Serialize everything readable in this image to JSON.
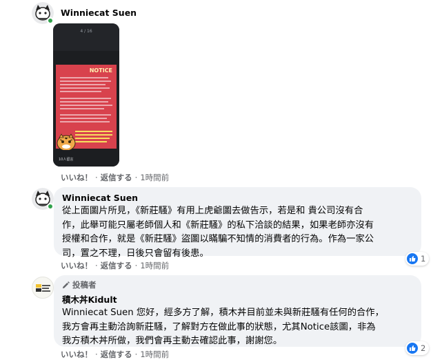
{
  "comments": [
    {
      "author": "Winniecat Suen",
      "image": {
        "page_counter": "4 / 16",
        "notice_title": "NOTICE",
        "footer_text": "10人留言"
      },
      "actions": {
        "like": "いいね！",
        "reply": "返信する",
        "time": "1時間前"
      }
    },
    {
      "author": "Winniecat Suen",
      "text": "從上面圖片所見，《新莊騷》有用上虎爺圖去做告示，若是和 貴公司沒有合作，此舉可能只屬老師個人和《新莊騷》的私下洽談的結果，如果老師亦沒有授權和合作，就是《新莊騷》盜圖以瞞騙不知情的消費者的行為。作為一家公司，置之不理，日後只會留有後患。",
      "lines": [
        "從上面圖片所見，《新莊騷》有用上虎爺圖去做告示，若是和 貴公司沒有合",
        "作，此舉可能只屬老師個人和《新莊騷》的私下洽談的結果，如果老師亦沒有",
        "授權和合作，就是《新莊騷》盜圖以瞞騙不知情的消費者的行為。作為一家公",
        "司，置之不理，日後只會留有後患。"
      ],
      "actions": {
        "like": "いいね！",
        "reply": "返信する",
        "time": "1時間前"
      },
      "reactions": {
        "icon": "like-icon",
        "count": "1"
      }
    },
    {
      "author_badge": "投稿者",
      "author": "積木丼Kidult",
      "lines": [
        "Winniecat Suen 您好，經多方了解，積木丼目前並未與新莊騷有任何的合作，",
        "我方會再主動洽詢新莊騷，了解對方在做此事的狀態，尤其Notice該圖，非為",
        "我方積木丼所做，我們會再主動去確認此事，謝謝您。"
      ],
      "actions": {
        "like": "いいね！",
        "reply": "返信する",
        "time": "1時間前"
      },
      "reactions": {
        "icon": "like-icon",
        "count": "2"
      }
    }
  ],
  "colors": {
    "bubble": "#f0f2f5",
    "secondary_text": "#65676b",
    "like_blue": "#1877f2",
    "online_green": "#31a24c",
    "notice_red": "#d8424d"
  }
}
